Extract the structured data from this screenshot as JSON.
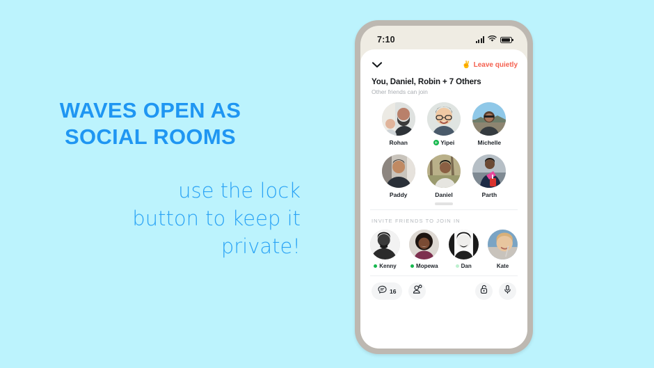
{
  "promo": {
    "headline_line1": "WAVES OPEN AS",
    "headline_line2": "SOCIAL ROOMS",
    "sub_line1": "use the lock",
    "sub_line2": "button to keep it",
    "sub_line3": "private!",
    "headline_color": "#1f96f2",
    "sub_color": "#2aa3f5",
    "background_color": "#bcf3fd"
  },
  "phone": {
    "frame_color": "#bdb8b1",
    "status_bg": "#efece3",
    "statusbar": {
      "time": "7:10",
      "signal_icon": "signal-bars-icon",
      "wifi_icon": "wifi-icon",
      "battery_icon": "battery-icon"
    },
    "header": {
      "collapse_icon": "chevron-down-icon",
      "leave_emoji": "✌️",
      "leave_label": "Leave quietly",
      "leave_color": "#f4604f",
      "room_title": "You, Daniel, Robin + 7 Others",
      "room_subtitle": "Other friends can join"
    },
    "participants": [
      {
        "name": "Rohan",
        "badge": false
      },
      {
        "name": "Yipei",
        "badge": true
      },
      {
        "name": "Michelle",
        "badge": false
      },
      {
        "name": "Paddy",
        "badge": false
      },
      {
        "name": "Daniel",
        "badge": false
      },
      {
        "name": "Parth",
        "badge": false
      },
      {
        "name": "",
        "badge": false
      },
      {
        "name": "",
        "badge": false
      },
      {
        "name": "",
        "badge": false
      }
    ],
    "invite": {
      "section_label": "INVITE FRIENDS TO JOIN IN",
      "people": [
        {
          "name": "Kenny",
          "status_color": "#16b84e"
        },
        {
          "name": "Mopewa",
          "status_color": "#16b84e"
        },
        {
          "name": "Dan",
          "status_color": "#bdf0cf"
        },
        {
          "name": "Kate",
          "status_color": ""
        }
      ]
    },
    "toolbar": {
      "chat_icon": "chat-bubble-icon",
      "chat_count": "16",
      "add_person_icon": "add-person-icon",
      "lock_icon": "unlocked-padlock-icon",
      "mic_icon": "microphone-icon"
    }
  }
}
